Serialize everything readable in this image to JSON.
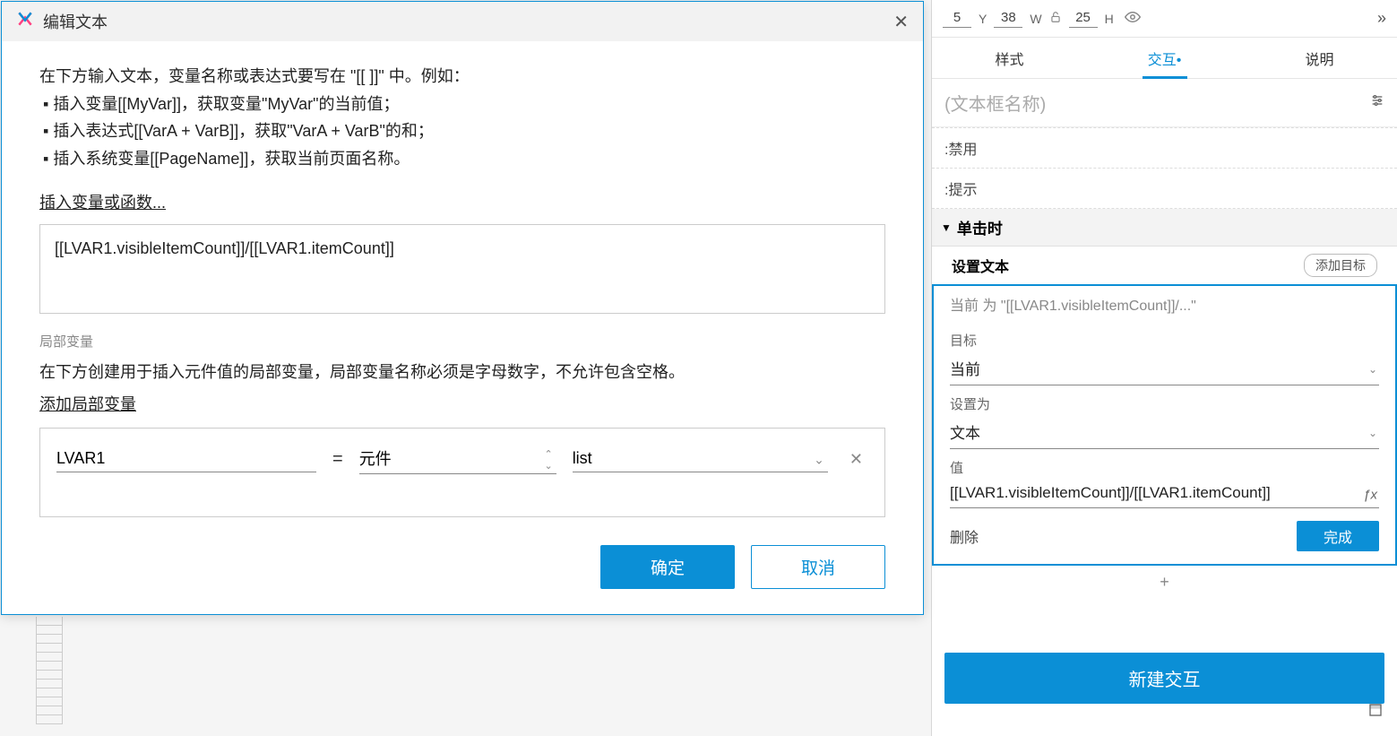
{
  "topbar": {
    "x_suffix": "5",
    "y_label": "Y",
    "y_value": "38",
    "w_label": "W",
    "w_value": "25",
    "h_label": "H"
  },
  "tabs": {
    "style": "样式",
    "interact": "交互",
    "notes": "说明"
  },
  "name_placeholder": "(文本框名称)",
  "states": {
    "disabled": ":禁用",
    "hint": ":提示"
  },
  "event_name": "单击时",
  "action": {
    "name": "设置文本",
    "add_target": "添加目标",
    "description": "当前 为 \"[[LVAR1.visibleItemCount]]/...\"",
    "target_label": "目标",
    "target_value": "当前",
    "setto_label": "设置为",
    "setto_value": "文本",
    "value_label": "值",
    "value_value": "[[LVAR1.visibleItemCount]]/[[LVAR1.itemCount]]",
    "delete": "删除",
    "done": "完成"
  },
  "add_action": "+",
  "new_interaction": "新建交互",
  "modal": {
    "title": "编辑文本",
    "instr_line1": "在下方输入文本，变量名称或表达式要写在 \"[[ ]]\" 中。例如：",
    "instr_b1": "▪ 插入变量[[MyVar]]，获取变量\"MyVar\"的当前值；",
    "instr_b2": "▪ 插入表达式[[VarA + VarB]]，获取\"VarA + VarB\"的和；",
    "instr_b3": "▪ 插入系统变量[[PageName]]，获取当前页面名称。",
    "insert_link": "插入变量或函数...",
    "expression": "[[LVAR1.visibleItemCount]]/[[LVAR1.itemCount]]",
    "local_var_header": "局部变量",
    "local_var_desc": "在下方创建用于插入元件值的局部变量，局部变量名称必须是字母数字，不允许包含空格。",
    "add_local_var": "添加局部变量",
    "var_name": "LVAR1",
    "var_type": "元件",
    "var_target": "list",
    "ok": "确定",
    "cancel": "取消"
  }
}
